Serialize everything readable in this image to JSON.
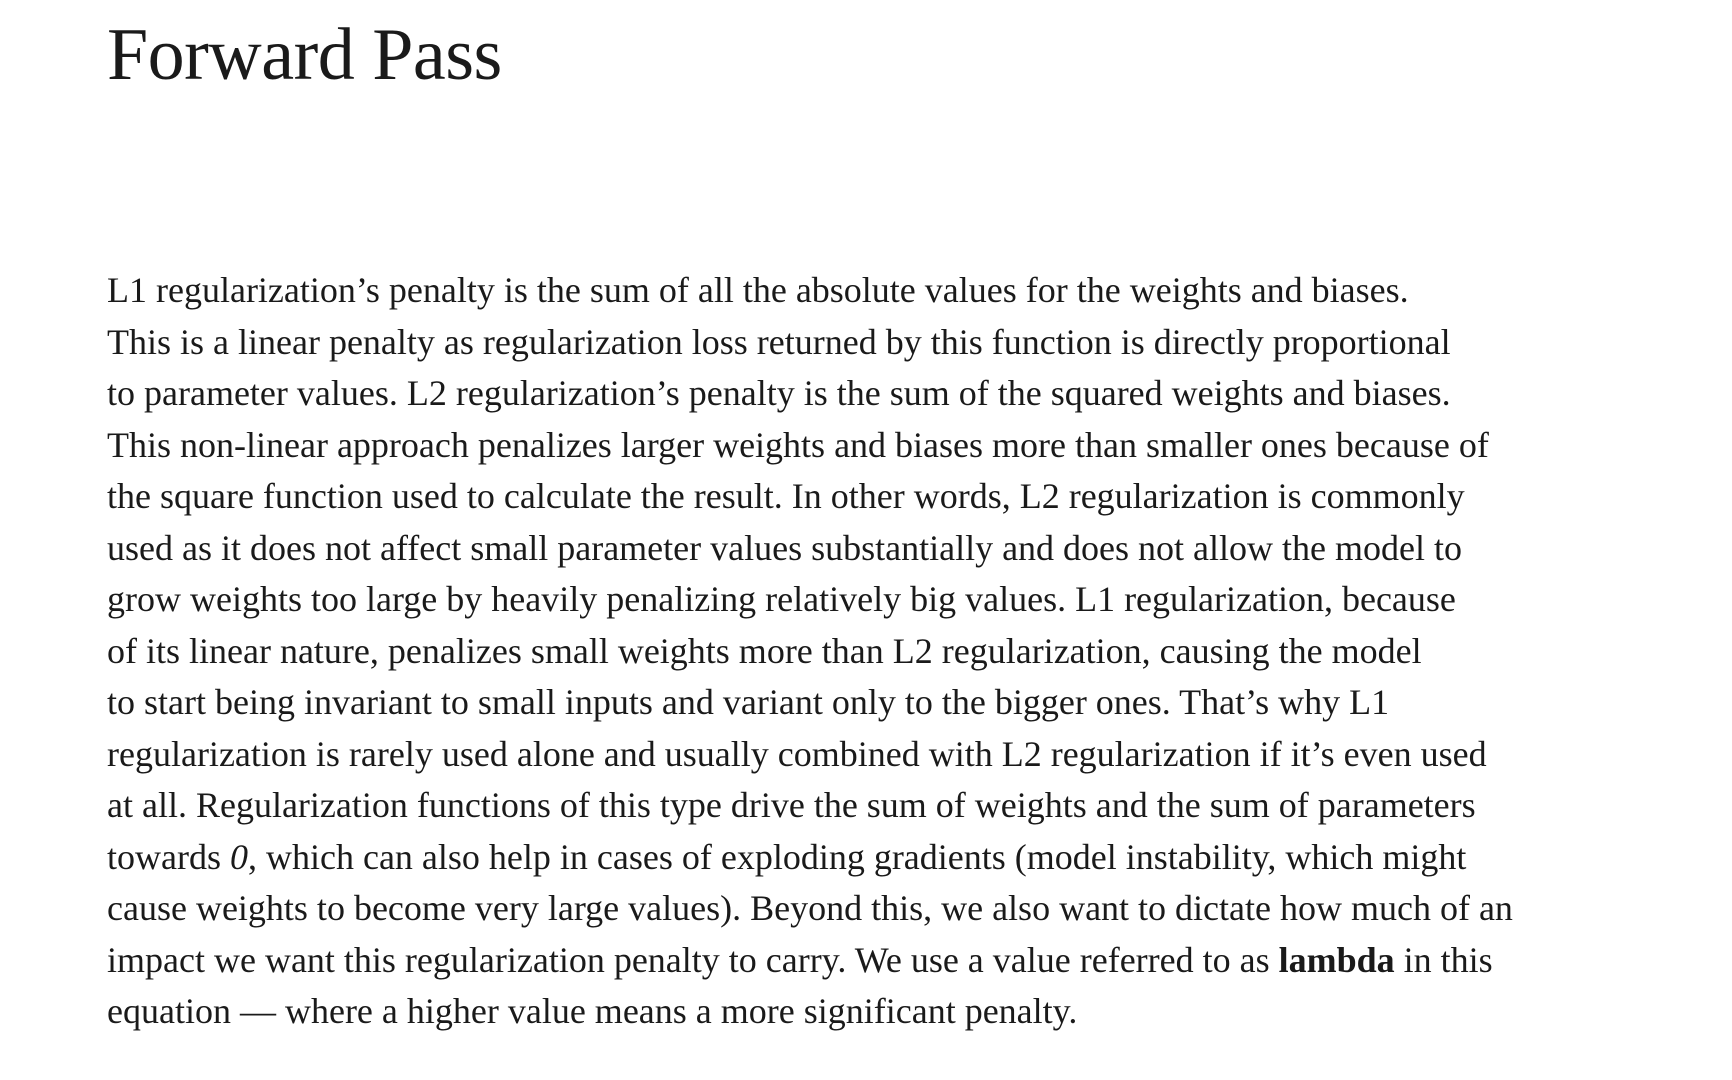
{
  "title": "Forward Pass",
  "paragraph": {
    "lines": [
      "L1 regularization’s penalty is the sum of all the absolute values for the weights and biases.",
      "This is a linear penalty as regularization loss returned by this function is directly proportional",
      "to parameter values. L2 regularization’s penalty is the sum of the squared weights and biases.",
      "This non-linear approach penalizes larger weights and biases more than smaller ones because of",
      "the square function used to calculate the result. In other words, L2 regularization is commonly",
      "used as it does not affect small parameter values substantially and does not allow the model to",
      "grow weights too large by heavily penalizing relatively big values. L1 regularization, because",
      "of its linear nature, penalizes small weights more than L2 regularization, causing the model",
      "to start being invariant to small inputs and variant only to the bigger ones. That’s why L1",
      "regularization is rarely used alone and usually combined with L2 regularization if it’s even used",
      "at all. Regularization functions of this type drive the sum of weights and the sum of parameters",
      {
        "before": "towards ",
        "italic": "0",
        "after": ", which can also help in cases of exploding gradients (model instability, which might"
      },
      "cause weights to become very large values). Beyond this, we also want to dictate how much of an",
      {
        "before": "impact we want this regularization penalty to carry. We use a value referred to as ",
        "bold": "lambda",
        "after": " in this"
      },
      "equation — where a higher value means a more significant penalty."
    ]
  }
}
